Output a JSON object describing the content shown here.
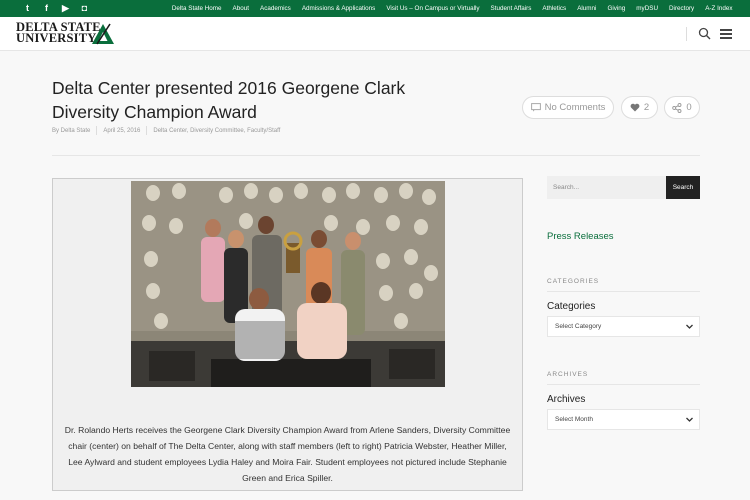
{
  "topbar": {
    "social": [
      {
        "icon": "twitter-icon",
        "glyph": "t"
      },
      {
        "icon": "facebook-icon",
        "glyph": "f"
      },
      {
        "icon": "youtube-icon",
        "glyph": "▶"
      },
      {
        "icon": "instagram-icon",
        "glyph": "◘"
      }
    ],
    "nav": [
      "Delta State Home",
      "About",
      "Academics",
      "Admissions & Applications",
      "Visit Us – On Campus or Virtually",
      "Student Affairs",
      "Athletics",
      "Alumni",
      "Giving",
      "myDSU",
      "Directory",
      "A-Z Index"
    ],
    "color": "#0a6e3c"
  },
  "header": {
    "logo_line1": "DELTA STATE",
    "logo_line2": "UNIVERSITY",
    "search_icon": "search-icon",
    "menu_icon": "hamburger-menu-icon"
  },
  "post": {
    "title": "Delta Center presented 2016 Georgene Clark Diversity Champion Award",
    "author": "By Delta State",
    "date": "April 25, 2016",
    "categories": "Delta Center, Diversity Committee, Faculty/Staff",
    "comments_label": "No Comments",
    "likes_count": "2",
    "shares_count": "0",
    "caption": "Dr. Rolando Herts receives the Georgene Clark Diversity Champion Award from Arlene Sanders, Diversity Committee chair (center) on behalf of The Delta Center, along with staff members (left to right) Patricia Webster, Heather Miller, Lee Aylward and student employees Lydia Haley and Moira Fair. Student employees not pictured include Stephanie Green and Erica Spiller."
  },
  "sidebar": {
    "search_placeholder": "Search...",
    "search_button": "Search",
    "press_link": "Press Releases",
    "categories_heading": "CATEGORIES",
    "categories_title": "Categories",
    "categories_select": "Select Category",
    "archives_heading": "ARCHIVES",
    "archives_title": "Archives",
    "archives_select": "Select Month"
  },
  "colors": {
    "brand_green": "#0a6e3c",
    "logo_accent": "#0a6e3c"
  }
}
